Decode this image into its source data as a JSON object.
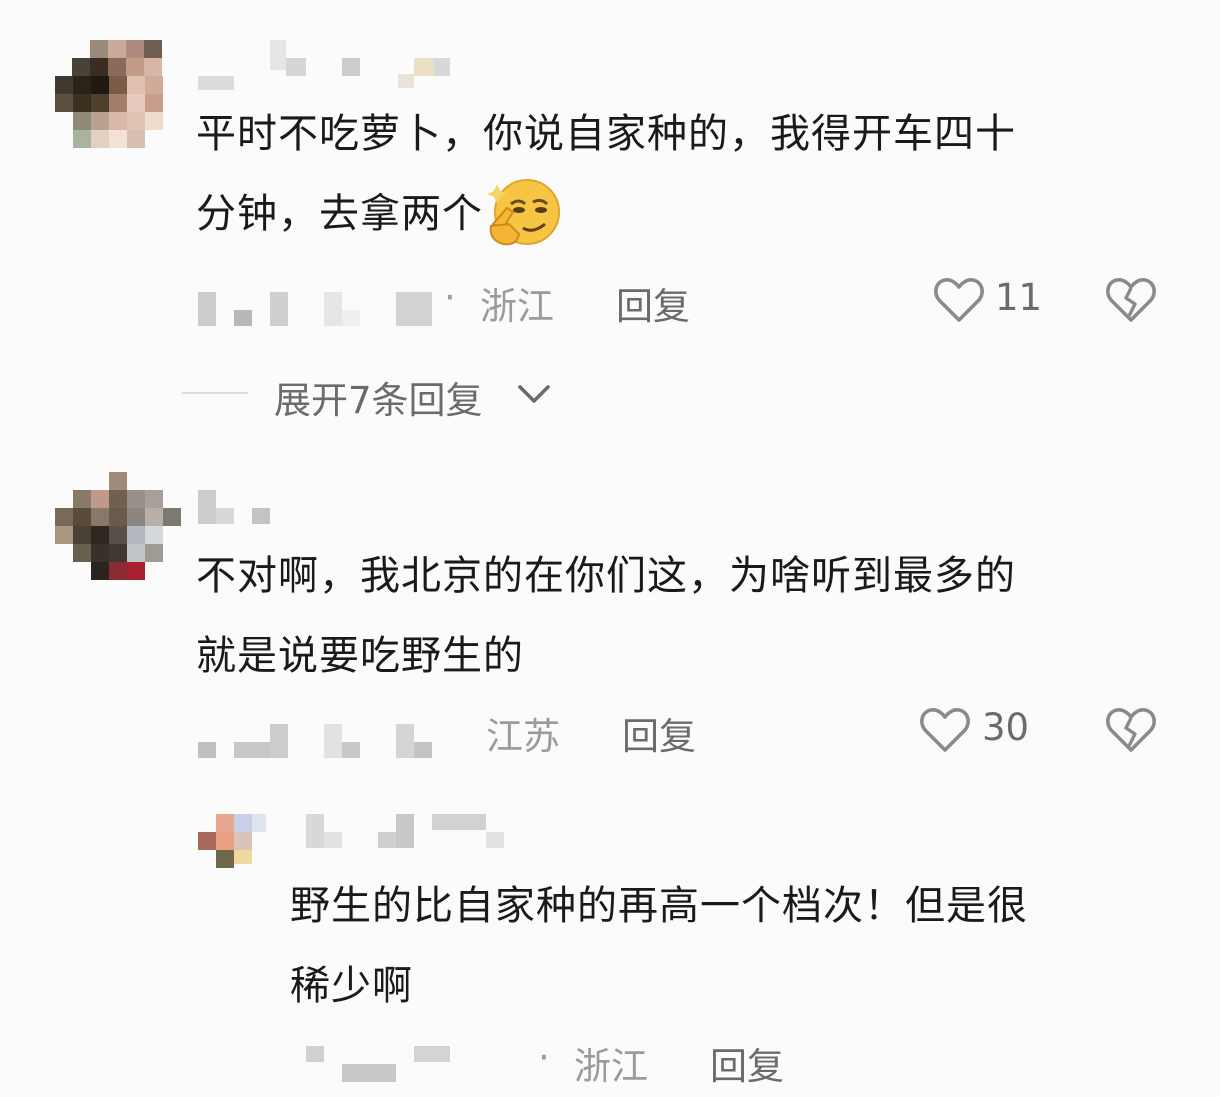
{
  "comments": [
    {
      "text": "平时不吃萝卜，你说自家种的，我得开车四十分钟，去拿两个",
      "line1": "平时不吃萝卜，你说自家种的，我得开车四十",
      "line2": "分钟，去拿两个",
      "emoji": "smirk-thinking-emoji",
      "separator": "·",
      "location": "浙江",
      "reply_label": "回复",
      "likes": "11",
      "expand_label": "展开7条回复"
    },
    {
      "text": "不对啊，我北京的在你们这，为啥听到最多的就是说要吃野生的",
      "line1": "不对啊，我北京的在你们这，为啥听到最多的",
      "line2": "就是说要吃野生的",
      "location": "江苏",
      "reply_label": "回复",
      "likes": "30"
    }
  ],
  "reply": {
    "text": "野生的比自家种的再高一个档次！但是很稀少啊",
    "line1": "野生的比自家种的再高一个档次！但是很",
    "line2": "稀少啊",
    "separator": "·",
    "location": "浙江",
    "reply_label": "回复"
  },
  "icons": {
    "like": "heart-outline-icon",
    "dislike": "broken-heart-icon",
    "expand": "chevron-down-icon"
  }
}
